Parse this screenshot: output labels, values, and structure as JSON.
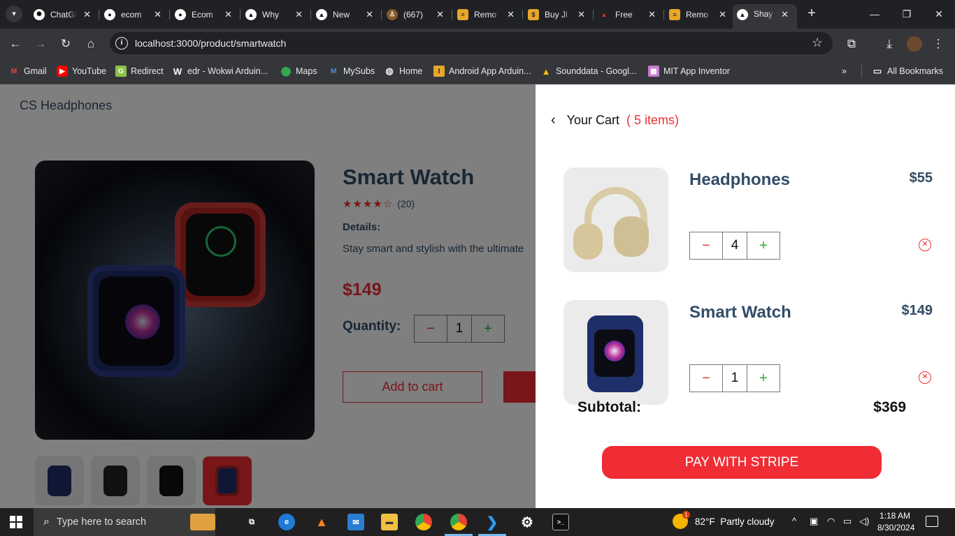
{
  "browser": {
    "tabs": [
      {
        "title": "ChatGPT",
        "icon": "chatgpt-icon"
      },
      {
        "title": "ecom",
        "icon": "github-icon"
      },
      {
        "title": "Ecom",
        "icon": "github-icon"
      },
      {
        "title": "Why",
        "icon": "vercel-icon"
      },
      {
        "title": "New",
        "icon": "vercel-icon"
      },
      {
        "title": "(667)",
        "icon": "figure-icon"
      },
      {
        "title": "Remo",
        "icon": "remo-icon"
      },
      {
        "title": "Buy Jl",
        "icon": "shop-icon"
      },
      {
        "title": "Free",
        "icon": "free-icon"
      },
      {
        "title": "Remo",
        "icon": "remo-icon"
      },
      {
        "title": "Shay",
        "icon": "vercel-icon",
        "active": true
      }
    ],
    "url": "localhost:3000/product/smartwatch",
    "bookmarks": [
      {
        "label": "Gmail",
        "icon": "gmail-icon"
      },
      {
        "label": "YouTube",
        "icon": "youtube-icon"
      },
      {
        "label": "Redirect",
        "icon": "redirect-icon"
      },
      {
        "label": "edr - Wokwi Arduin...",
        "icon": "wokwi-icon"
      },
      {
        "label": "Maps",
        "icon": "maps-icon"
      },
      {
        "label": "MySubs",
        "icon": "mysubs-icon"
      },
      {
        "label": "Home",
        "icon": "home-globe-icon"
      },
      {
        "label": "Android App Arduin...",
        "icon": "instructables-icon"
      },
      {
        "label": "Sounddata - Googl...",
        "icon": "drive-icon"
      },
      {
        "label": "MIT App Inventor",
        "icon": "appinventor-icon"
      }
    ],
    "all_bookmarks": "All Bookmarks",
    "more": "»"
  },
  "page": {
    "brand": "CS Headphones",
    "product": {
      "name": "Smart Watch",
      "rating": 4,
      "rating_stars": "★★★★☆",
      "reviews": "(20)",
      "details_heading": "Details:",
      "details_text": "Stay smart and stylish with the ultimate",
      "price": "$149",
      "quantity_label": "Quantity:",
      "quantity": "1",
      "add_to_cart": "Add to cart"
    }
  },
  "cart": {
    "title": "Your Cart",
    "count": "( 5 items)",
    "items": [
      {
        "name": "Headphones",
        "price": "$55",
        "quantity": "4"
      },
      {
        "name": "Smart Watch",
        "price": "$149",
        "quantity": "1"
      }
    ],
    "subtotal_label": "Subtotal:",
    "subtotal": "$369",
    "pay_button": "PAY WITH STRIPE"
  },
  "taskbar": {
    "search_placeholder": "Type here to search",
    "weather_temp": "82°F",
    "weather_desc": "Partly cloudy",
    "weather_badge": "1",
    "time": "1:18 AM",
    "date": "8/30/2024"
  },
  "colors": {
    "accent": "#f02d34",
    "text_dark": "#324d67",
    "plus_green": "#31a831"
  }
}
